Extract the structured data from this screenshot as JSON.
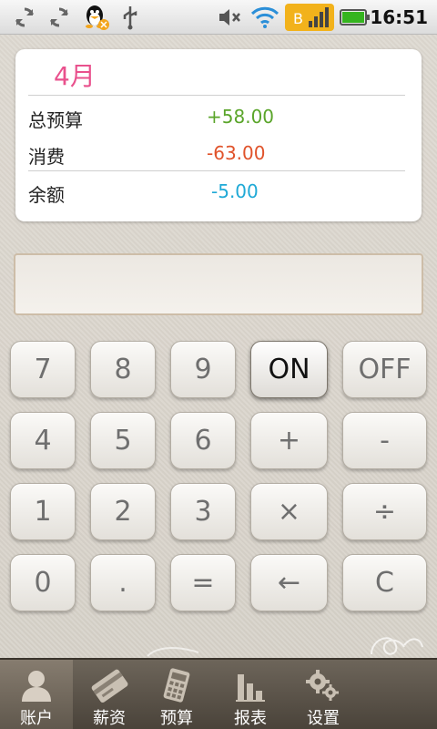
{
  "status_bar": {
    "time": "16:51",
    "icons": [
      "sync-icon",
      "sync-icon",
      "qq-penguin-icon",
      "usb-icon",
      "mute-icon",
      "wifi-icon",
      "bluetooth-signal-icon",
      "battery-icon"
    ]
  },
  "summary": {
    "month": "4月",
    "rows": [
      {
        "label": "总预算",
        "value": "+58.00",
        "color": "#5aa52a"
      },
      {
        "label": "消费",
        "value": "-63.00",
        "color": "#e0532b"
      },
      {
        "label": "余额",
        "value": "-5.00",
        "color": "#1fa9d6"
      }
    ]
  },
  "display": {
    "value": ""
  },
  "keypad": {
    "rows": [
      [
        "7",
        "8",
        "9",
        "ON",
        "OFF"
      ],
      [
        "4",
        "5",
        "6",
        "+",
        "-"
      ],
      [
        "1",
        "2",
        "3",
        "×",
        "÷"
      ],
      [
        "0",
        ".",
        "=",
        "←",
        "C"
      ]
    ],
    "active_key": "ON"
  },
  "tabs": [
    {
      "label": "账户",
      "icon": "person-icon",
      "selected": true
    },
    {
      "label": "薪资",
      "icon": "card-icon",
      "selected": false
    },
    {
      "label": "预算",
      "icon": "calculator-icon",
      "selected": false
    },
    {
      "label": "报表",
      "icon": "bar-chart-icon",
      "selected": false
    },
    {
      "label": "设置",
      "icon": "gears-icon",
      "selected": false
    }
  ]
}
